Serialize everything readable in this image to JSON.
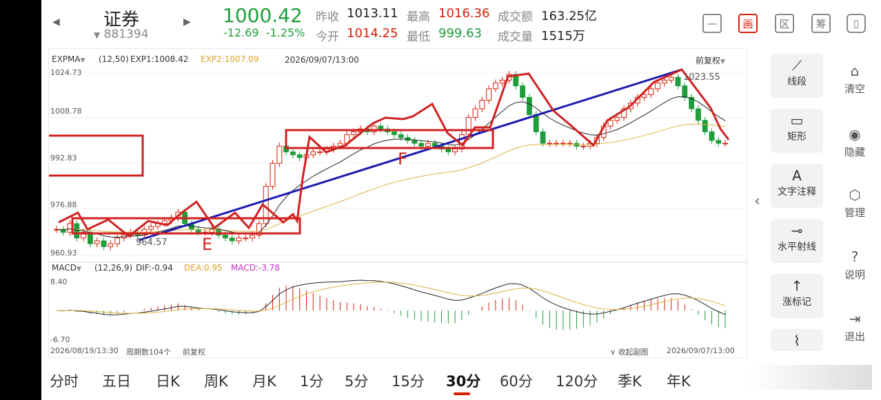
{
  "header": {
    "name": "证券",
    "code": "881394",
    "price": "1000.42",
    "change": "-12.69",
    "change_pct": "-1.25%"
  },
  "quote": {
    "prev_close_label": "昨收",
    "prev_close": "1013.11",
    "high_label": "最高",
    "high": "1016.36",
    "amount_label": "成交额",
    "amount": "163.25亿",
    "open_label": "今开",
    "open": "1014.25",
    "low_label": "最低",
    "low": "999.63",
    "volume_label": "成交量",
    "volume": "1515万"
  },
  "icons": [
    "minus-square-icon",
    "draw-icon",
    "region-icon",
    "chip-icon",
    "screen-switch-icon"
  ],
  "draw_btn": "画",
  "region_btn": "区",
  "chip_btn": "筹",
  "chart": {
    "ind_name": "EXPMA",
    "ind_params": "(12,50)",
    "exp1": "EXP1:1008.42",
    "exp2": "EXP2:1007.09",
    "date": "2026/09/07/13:00",
    "adjust": "前复权",
    "y_ticks": [
      "1024.73",
      "1008.78",
      "992.83",
      "976.88",
      "960.93"
    ],
    "high_label": "1023.55",
    "low_label": "964.57",
    "mark_e": "E",
    "mark_f": "F",
    "macd_name": "MACD",
    "macd_params": "(12,26,9)",
    "dif": "DIF:-0.94",
    "dea": "DEA:0.95",
    "macd": "MACD:-3.78",
    "macd_top": "8.40",
    "macd_bottom": "-6.70",
    "start_date": "2026/08/19/13:30",
    "period_count": "周期数104个",
    "adjust2": "前复权",
    "collapse": "收起副图",
    "end_date": "2026/09/07/13:00"
  },
  "tools": [
    "线段",
    "矩形",
    "文字注释",
    "水平射线",
    "涨标记"
  ],
  "side": [
    "清空",
    "隐藏",
    "管理",
    "说明",
    "退出"
  ],
  "tabs": [
    "分时",
    "五日",
    "日K",
    "周K",
    "月K",
    "1分",
    "5分",
    "15分",
    "30分",
    "60分",
    "120分",
    "季K",
    "年K"
  ],
  "active_tab": "30分",
  "colors": {
    "up": "#d81e06",
    "down": "#1f9d3a",
    "exp1": "#222222",
    "exp2": "#e0b040",
    "trend": "#1a1ab0"
  },
  "chart_data": {
    "type": "candlestick",
    "closes": [
      970,
      969,
      972,
      967,
      969,
      965,
      966,
      964,
      965,
      967,
      968,
      969,
      968,
      970,
      971,
      972,
      973,
      974,
      976,
      972,
      970,
      969,
      969,
      970,
      968,
      967,
      966,
      967,
      967,
      968,
      972,
      985,
      993,
      999,
      997,
      996,
      995,
      996,
      997,
      997,
      998,
      999,
      1000,
      1003,
      1004,
      1005,
      1004,
      1006,
      1005,
      1004,
      1003,
      1002,
      1001,
      1000,
      999,
      1000,
      999,
      998,
      997,
      998,
      1003,
      1009,
      1012,
      1015,
      1019,
      1021,
      1022,
      1024,
      1020,
      1016,
      1010,
      1004,
      1000,
      1000,
      1000,
      1000,
      1000,
      999,
      999,
      1000,
      1002,
      1006,
      1008,
      1009,
      1012,
      1014,
      1016,
      1017,
      1019,
      1021,
      1022,
      1023,
      1020,
      1016,
      1012,
      1008,
      1004,
      1001,
      1000,
      1000
    ],
    "y_range": [
      960.93,
      1024.73
    ]
  }
}
